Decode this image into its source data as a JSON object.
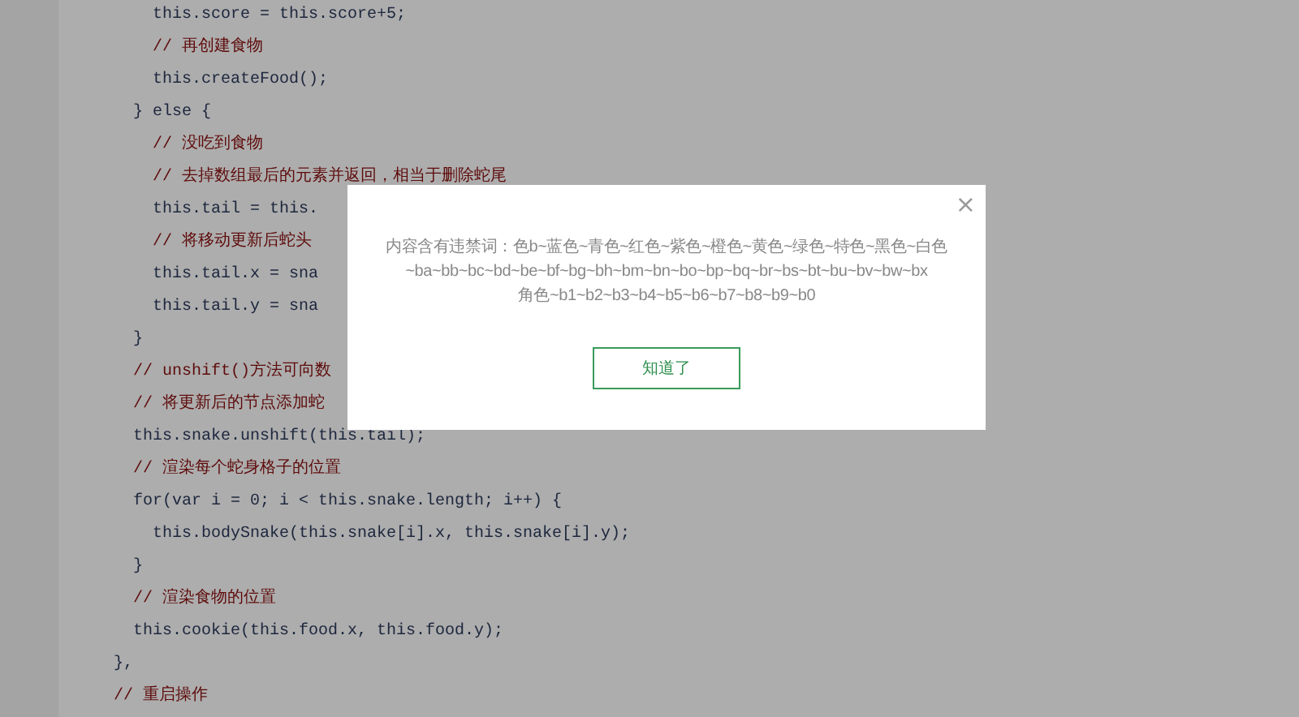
{
  "code_lines": [
    {
      "kind": "code",
      "text": "      this.score = this.score+5;"
    },
    {
      "kind": "comment",
      "text": "      // 再创建食物"
    },
    {
      "kind": "code",
      "text": "      this.createFood();"
    },
    {
      "kind": "code",
      "text": "    } else {"
    },
    {
      "kind": "comment",
      "text": "      // 没吃到食物"
    },
    {
      "kind": "comment",
      "text": "      // 去掉数组最后的元素并返回，相当于删除蛇尾"
    },
    {
      "kind": "code",
      "text": "      this.tail = this."
    },
    {
      "kind": "comment",
      "text": "      // 将移动更新后蛇头"
    },
    {
      "kind": "code",
      "text": "      this.tail.x = sna"
    },
    {
      "kind": "code",
      "text": "      this.tail.y = sna"
    },
    {
      "kind": "code",
      "text": "    }"
    },
    {
      "kind": "comment",
      "text": "    // unshift()方法可向数"
    },
    {
      "kind": "comment",
      "text": "    // 将更新后的节点添加蛇"
    },
    {
      "kind": "code",
      "text": "    this.snake.unshift(this.tail);"
    },
    {
      "kind": "comment",
      "text": "    // 渲染每个蛇身格子的位置"
    },
    {
      "kind": "code",
      "text": "    for(var i = 0; i < this.snake.length; i++) {"
    },
    {
      "kind": "code",
      "text": "      this.bodySnake(this.snake[i].x, this.snake[i].y);"
    },
    {
      "kind": "code",
      "text": "    }"
    },
    {
      "kind": "comment",
      "text": "    // 渲染食物的位置"
    },
    {
      "kind": "code",
      "text": "    this.cookie(this.food.x, this.food.y);"
    },
    {
      "kind": "code",
      "text": "  },"
    },
    {
      "kind": "comment",
      "text": "  // 重启操作"
    }
  ],
  "dialog": {
    "close": "×",
    "message_lines": [
      "内容含有违禁词：色b~蓝色~青色~红色~紫色~橙色~黄色~绿色~特色~黑色~白色",
      "~ba~bb~bc~bd~be~bf~bg~bh~bm~bn~bo~bp~bq~br~bs~bt~bu~bv~bw~bx",
      "角色~b1~b2~b3~b4~b5~b6~b7~b8~b9~b0"
    ],
    "button": "知道了"
  }
}
